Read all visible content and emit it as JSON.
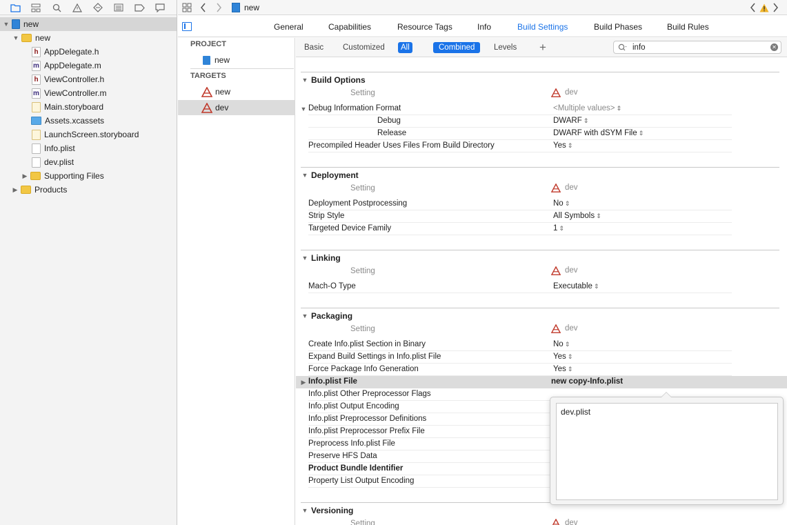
{
  "navigator": {
    "toolbar_icons": [
      "folder-icon",
      "hierarchy-icon",
      "search-icon",
      "warning-icon",
      "breakpoint-icon",
      "list-icon",
      "tag-icon",
      "comment-icon"
    ],
    "items": [
      {
        "label": "new",
        "type": "project",
        "indent": 0,
        "expanded": true,
        "selected": true
      },
      {
        "label": "new",
        "type": "folder",
        "indent": 1,
        "expanded": true
      },
      {
        "label": "AppDelegate.h",
        "type": "h",
        "indent": 2
      },
      {
        "label": "AppDelegate.m",
        "type": "m",
        "indent": 2
      },
      {
        "label": "ViewController.h",
        "type": "h",
        "indent": 2
      },
      {
        "label": "ViewController.m",
        "type": "m",
        "indent": 2
      },
      {
        "label": "Main.storyboard",
        "type": "storyboard",
        "indent": 2
      },
      {
        "label": "Assets.xcassets",
        "type": "assets",
        "indent": 2
      },
      {
        "label": "LaunchScreen.storyboard",
        "type": "storyboard",
        "indent": 2
      },
      {
        "label": "Info.plist",
        "type": "doc",
        "indent": 2
      },
      {
        "label": "dev.plist",
        "type": "doc",
        "indent": 2
      },
      {
        "label": "Supporting Files",
        "type": "folder",
        "indent": 2,
        "expanded": false
      },
      {
        "label": "Products",
        "type": "folder",
        "indent": 1,
        "expanded": false
      }
    ]
  },
  "jumpbar": {
    "file_label": "new"
  },
  "editor_tabs": [
    {
      "label": "General",
      "active": false
    },
    {
      "label": "Capabilities",
      "active": false
    },
    {
      "label": "Resource Tags",
      "active": false
    },
    {
      "label": "Info",
      "active": false
    },
    {
      "label": "Build Settings",
      "active": true
    },
    {
      "label": "Build Phases",
      "active": false
    },
    {
      "label": "Build Rules",
      "active": false
    }
  ],
  "targets_panel": {
    "project_header": "PROJECT",
    "project_item": "new",
    "targets_header": "TARGETS",
    "targets": [
      {
        "label": "new",
        "selected": false
      },
      {
        "label": "dev",
        "selected": true
      }
    ]
  },
  "filter_bar": {
    "basic": "Basic",
    "customized": "Customized",
    "all": "All",
    "combined": "Combined",
    "levels": "Levels",
    "search_value": "info"
  },
  "settings": {
    "column_setting": "Setting",
    "column_target": "dev",
    "sections": [
      {
        "title": "Build Options",
        "rows": [
          {
            "name": "Debug Information Format",
            "value": "<Multiple values>",
            "muted": true,
            "expanded": true
          },
          {
            "name": "Debug",
            "value": "DWARF",
            "sub": true
          },
          {
            "name": "Release",
            "value": "DWARF with dSYM File",
            "sub": true
          },
          {
            "name": "Precompiled Header Uses Files From Build Directory",
            "value": "Yes"
          }
        ]
      },
      {
        "title": "Deployment",
        "rows": [
          {
            "name": "Deployment Postprocessing",
            "value": "No"
          },
          {
            "name": "Strip Style",
            "value": "All Symbols"
          },
          {
            "name": "Targeted Device Family",
            "value": "1"
          }
        ]
      },
      {
        "title": "Linking",
        "rows": [
          {
            "name": "Mach-O Type",
            "value": "Executable"
          }
        ]
      },
      {
        "title": "Packaging",
        "rows": [
          {
            "name": "Create Info.plist Section in Binary",
            "value": "No"
          },
          {
            "name": "Expand Build Settings in Info.plist File",
            "value": "Yes"
          },
          {
            "name": "Force Package Info Generation",
            "value": "Yes"
          },
          {
            "name": "Info.plist File",
            "value": "new copy-Info.plist",
            "highlight": true
          },
          {
            "name": "Info.plist Other Preprocessor Flags",
            "value": ""
          },
          {
            "name": "Info.plist Output Encoding",
            "value": ""
          },
          {
            "name": "Info.plist Preprocessor Definitions",
            "value": ""
          },
          {
            "name": "Info.plist Preprocessor Prefix File",
            "value": ""
          },
          {
            "name": "Preprocess Info.plist File",
            "value": ""
          },
          {
            "name": "Preserve HFS Data",
            "value": ""
          },
          {
            "name": "Product Bundle Identifier",
            "value": "",
            "bold": true
          },
          {
            "name": "Property List Output Encoding",
            "value": ""
          }
        ]
      },
      {
        "title": "Versioning",
        "rows": []
      }
    ]
  },
  "popover": {
    "text_value": "dev.plist"
  },
  "colors": {
    "accent": "#1a73e8",
    "selection_gray": "#dcdcdc",
    "warning": "#f0b429"
  }
}
